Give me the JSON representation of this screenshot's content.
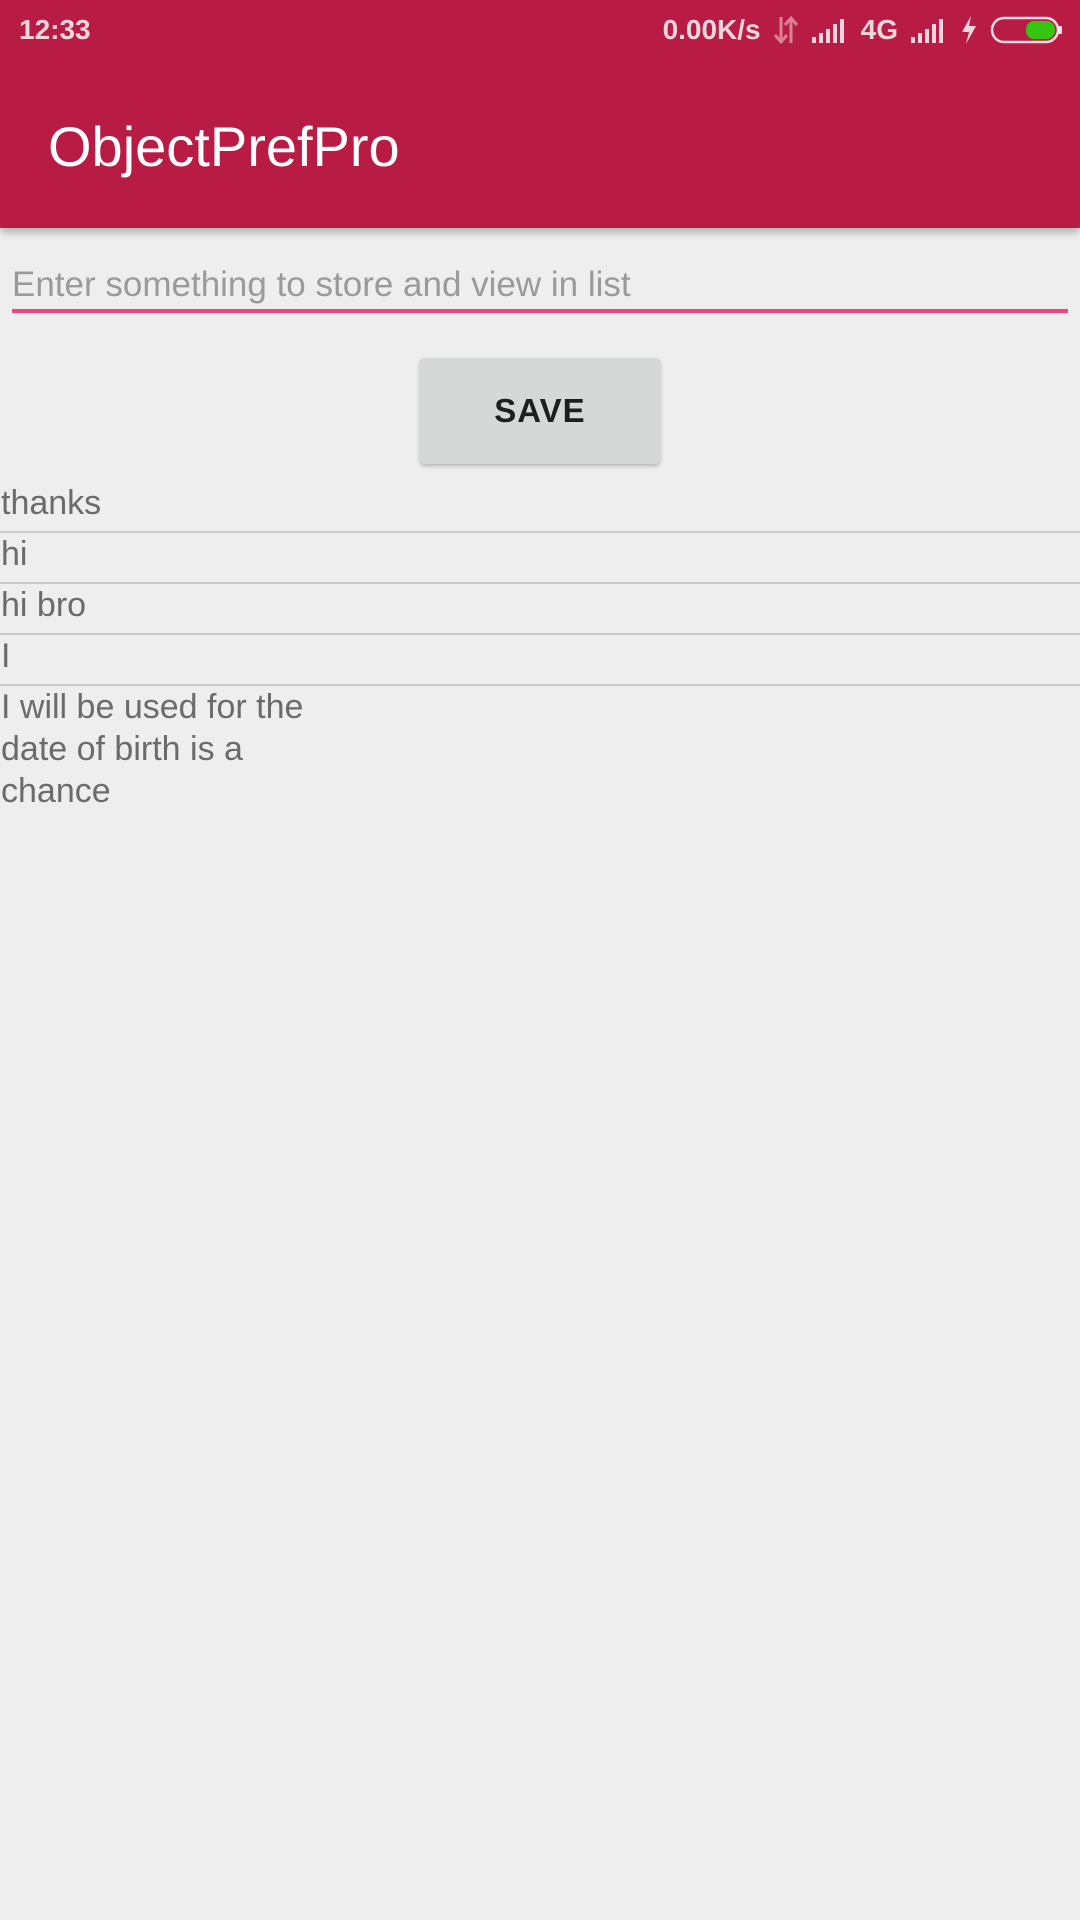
{
  "status_bar": {
    "time": "12:33",
    "net_speed": "0.00K/s",
    "network_type": "4G",
    "icons": [
      "data-transfer-icon",
      "signal-icon",
      "signal-icon",
      "charging-icon",
      "battery-icon"
    ],
    "battery_color": "#35c40f"
  },
  "app_bar": {
    "title": "ObjectPrefPro",
    "color": "#b81c44"
  },
  "form": {
    "input_placeholder": "Enter something to store and view in list",
    "input_value": "",
    "accent_color": "#f0457c",
    "save_label": "SAVE"
  },
  "list": {
    "items": [
      "thanks",
      "hi",
      "hi bro",
      "I",
      "I will be used for the date of birth is a chance"
    ]
  }
}
